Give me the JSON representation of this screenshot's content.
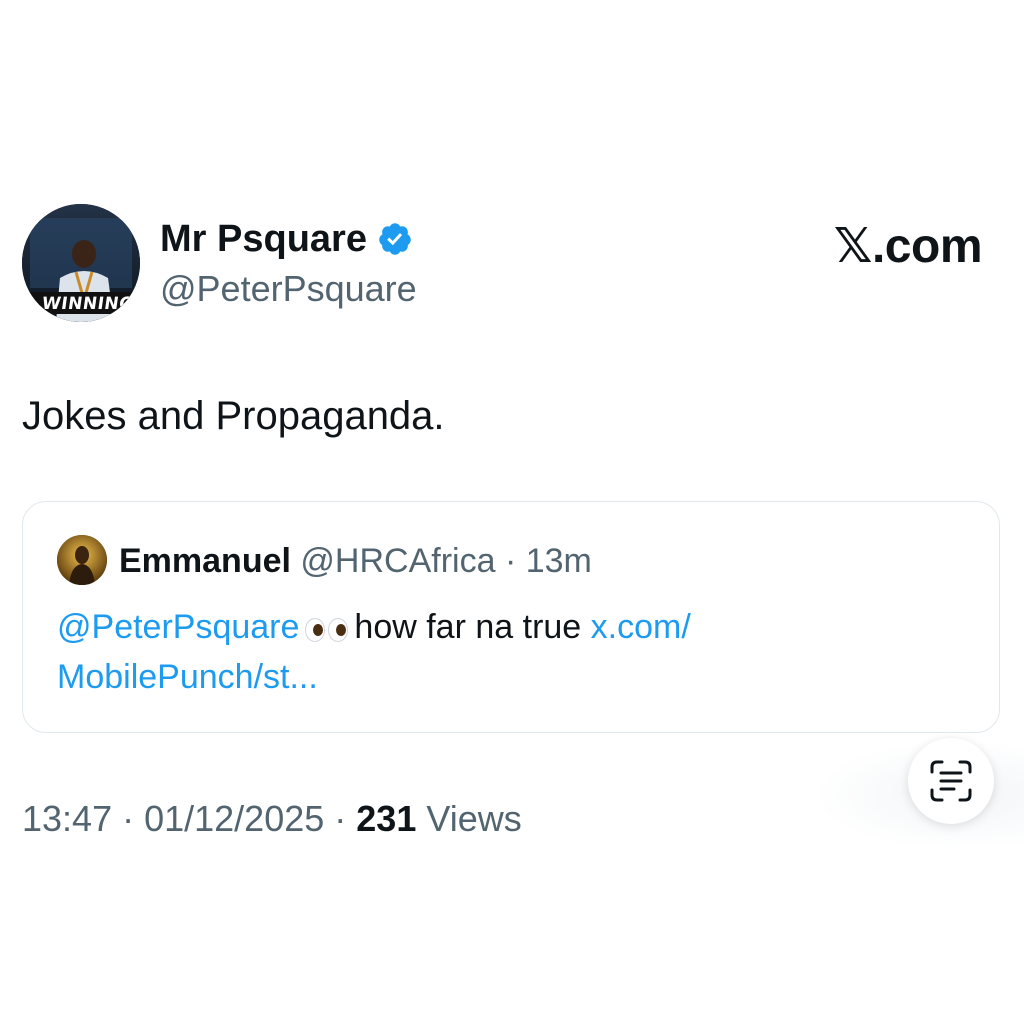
{
  "author": {
    "name": "Mr Psquare",
    "handle": "@PeterPsquare",
    "verified": true,
    "avatar_caption": "WINNING"
  },
  "brand": {
    "label": ".com",
    "x_glyph": "𝕏"
  },
  "tweet": {
    "text": "Jokes and Propaganda."
  },
  "quote": {
    "name": "Emmanuel",
    "handle": "@HRCAfrica",
    "separator": " · ",
    "time": "13m",
    "mention": "@PeterPsquare",
    "emoji": "eyes",
    "text": "how far na true",
    "link_line1": "x.com/",
    "link_line2": "MobilePunch/st..."
  },
  "meta": {
    "time": "13:47",
    "sep1": " · ",
    "date": "01/12/2025",
    "sep2": " · ",
    "views_count": "231",
    "views_label": " Views"
  },
  "colors": {
    "link": "#1d9bf0",
    "muted": "#536471",
    "text": "#0f1419",
    "verified": "#1d9bf0"
  },
  "icons": {
    "verified": "verified-badge-icon",
    "fab": "text-scan-icon"
  }
}
